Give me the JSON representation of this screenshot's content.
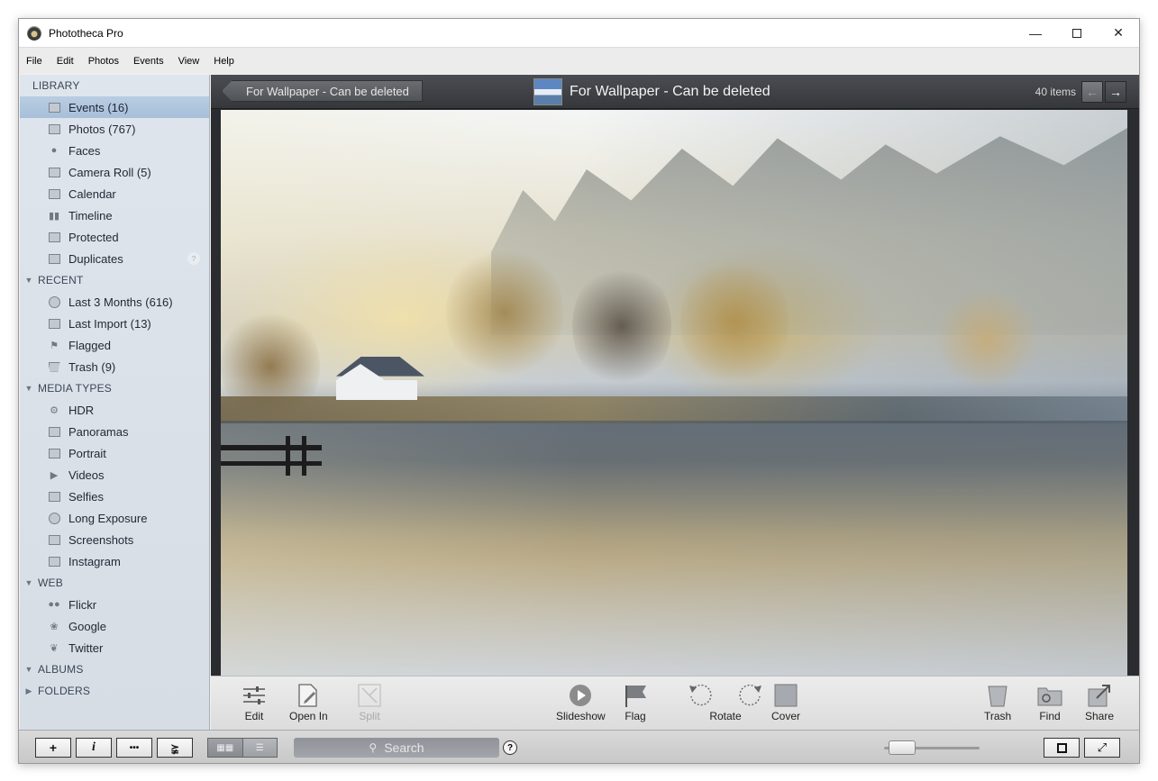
{
  "window": {
    "title": "Phototheca Pro"
  },
  "menu": [
    "File",
    "Edit",
    "Photos",
    "Events",
    "View",
    "Help"
  ],
  "sidebar": {
    "library_header": "LIBRARY",
    "library": [
      {
        "label": "Events (16)",
        "icon": "events-icon"
      },
      {
        "label": "Photos (767)",
        "icon": "photos-icon"
      },
      {
        "label": "Faces",
        "icon": "faces-icon"
      },
      {
        "label": "Camera Roll (5)",
        "icon": "camera-roll-icon"
      },
      {
        "label": "Calendar",
        "icon": "calendar-icon"
      },
      {
        "label": "Timeline",
        "icon": "timeline-icon"
      },
      {
        "label": "Protected",
        "icon": "protected-icon"
      },
      {
        "label": "Duplicates",
        "icon": "duplicates-icon"
      }
    ],
    "recent_header": "RECENT",
    "recent": [
      {
        "label": "Last 3 Months (616)",
        "icon": "clock-icon"
      },
      {
        "label": "Last Import (13)",
        "icon": "import-icon"
      },
      {
        "label": "Flagged",
        "icon": "flag-icon"
      },
      {
        "label": "Trash (9)",
        "icon": "trash-icon"
      }
    ],
    "media_header": "MEDIA TYPES",
    "media": [
      {
        "label": "HDR",
        "icon": "hdr-icon"
      },
      {
        "label": "Panoramas",
        "icon": "panorama-icon"
      },
      {
        "label": "Portrait",
        "icon": "portrait-icon"
      },
      {
        "label": "Videos",
        "icon": "video-icon"
      },
      {
        "label": "Selfies",
        "icon": "selfie-icon"
      },
      {
        "label": "Long Exposure",
        "icon": "long-exposure-icon"
      },
      {
        "label": "Screenshots",
        "icon": "screenshot-icon"
      },
      {
        "label": "Instagram",
        "icon": "instagram-icon"
      }
    ],
    "web_header": "WEB",
    "web": [
      {
        "label": "Flickr",
        "icon": "flickr-icon"
      },
      {
        "label": "Google",
        "icon": "google-icon"
      },
      {
        "label": "Twitter",
        "icon": "twitter-icon"
      }
    ],
    "albums_header": "ALBUMS",
    "folders_header": "FOLDERS"
  },
  "header": {
    "back_label": "For Wallpaper - Can be deleted",
    "event_title": "For Wallpaper - Can be deleted",
    "item_count": "40 items"
  },
  "toolbar": {
    "edit": "Edit",
    "open_in": "Open In",
    "split": "Split",
    "slideshow": "Slideshow",
    "flag": "Flag",
    "rotate": "Rotate",
    "cover": "Cover",
    "trash": "Trash",
    "find": "Find",
    "share": "Share"
  },
  "statusbar": {
    "add": "+",
    "info": "i",
    "more": "•••",
    "key": "⪶",
    "search_placeholder": "Search",
    "help": "?"
  },
  "colors": {
    "selected_row": "#a7bfd9",
    "sidebar_bg": "#dfe5ec",
    "main_bg": "#2a2c30"
  }
}
